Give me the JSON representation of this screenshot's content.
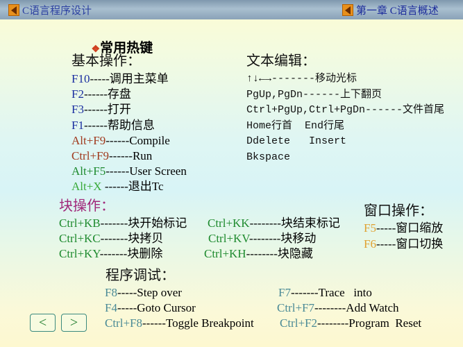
{
  "header": {
    "left_title": "C语言程序设计",
    "right_title": "第一章 C语言概述"
  },
  "page_title": "常用热键",
  "colors": {
    "blue": "#1a2ea0",
    "brown": "#a03a1e",
    "green": "#1e8a2e",
    "lightgreen": "#3aaa3a",
    "purple": "#a0287a",
    "orange": "#e0a030",
    "teal": "#4a8a96"
  },
  "basic": {
    "heading": "基本操作：",
    "items": [
      {
        "key": "F10",
        "rest": "-----调用主菜单",
        "color": "blue"
      },
      {
        "key": "F2",
        "rest": "------存盘",
        "color": "blue"
      },
      {
        "key": "F3",
        "rest": "------打开",
        "color": "blue"
      },
      {
        "key": "F1",
        "rest": "------帮助信息",
        "color": "blue"
      },
      {
        "key": "Alt+F9",
        "rest": "------Compile",
        "color": "brown"
      },
      {
        "key": "Ctrl+F9",
        "rest": "------Run",
        "color": "brown"
      },
      {
        "key": "Alt+F5",
        "rest": "------User Screen",
        "color": "green"
      },
      {
        "key": "Alt+X",
        "rest": " ------退出Tc",
        "color": "lightgreen"
      }
    ]
  },
  "edit": {
    "heading": "文本编辑：",
    "items": [
      {
        "key": "↑↓←→",
        "rest": "-------移动光标"
      },
      {
        "key": "PgUp,PgDn",
        "rest": "------上下翻页"
      },
      {
        "key": "Ctrl+PgUp,Ctrl+PgDn",
        "rest": "------文件首尾"
      },
      {
        "key": "Home行首",
        "rest": "  End行尾"
      },
      {
        "key": "Ddelete",
        "rest": "   Insert"
      },
      {
        "key": "Bkspace",
        "rest": ""
      }
    ]
  },
  "block": {
    "heading": "块操作：",
    "left": [
      {
        "key": "Ctrl+KB",
        "rest": "-------块开始标记"
      },
      {
        "key": "Ctrl+KC",
        "rest": "-------块拷贝"
      },
      {
        "key": "Ctrl+KY",
        "rest": "-------块删除"
      }
    ],
    "right": [
      {
        "key": "Ctrl+KK",
        "rest": "--------块结束标记"
      },
      {
        "key": "Ctrl+KV",
        "rest": "--------块移动"
      },
      {
        "key": "Ctrl+KH",
        "rest": "--------块隐藏"
      }
    ]
  },
  "window": {
    "heading": "窗口操作：",
    "items": [
      {
        "key": "F5",
        "rest": "-----窗口缩放"
      },
      {
        "key": "F6",
        "rest": "-----窗口切换"
      }
    ]
  },
  "debug": {
    "heading": "程序调试：",
    "left": [
      {
        "key": "F8",
        "rest": "-----Step over"
      },
      {
        "key": "F4",
        "rest": "-----Goto Cursor"
      },
      {
        "key": "Ctrl+F8",
        "rest": "------Toggle Breakpoint"
      }
    ],
    "right": [
      {
        "key": "F7",
        "rest": "-------Trace   into"
      },
      {
        "key": "Ctrl+F7",
        "rest": "--------Add Watch"
      },
      {
        "key": "Ctrl+F2",
        "rest": "--------Program  Reset"
      }
    ]
  },
  "nav": {
    "prev": "<",
    "next": ">"
  }
}
